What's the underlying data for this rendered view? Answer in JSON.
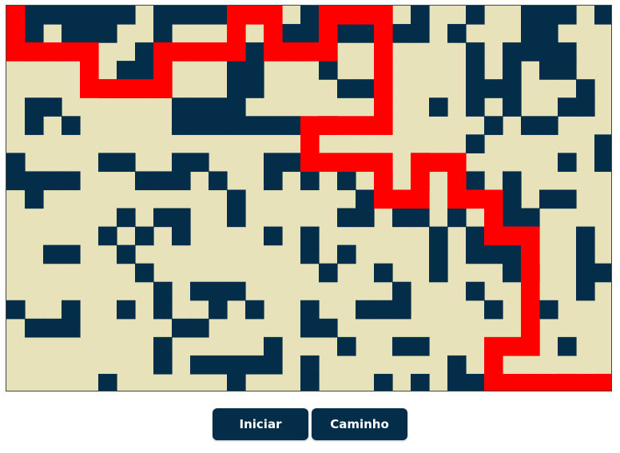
{
  "colors": {
    "wall": "#042d4a",
    "floor": "#e8e2bb",
    "path": "#ff0000",
    "button_bg": "#042d4a",
    "button_text": "#ffffff"
  },
  "maze": {
    "rows": 21,
    "cols": 33,
    "grid": [
      "#######.####....#...#.#..#..###.#",
      ".#.###..#......##.#####.#...##...",
      ".......#.....#...#.......#.####..",
      "......###...##...#.......#.#.##..",
      ".....####...##....##.....###...#.",
      ".##......####..........#.#.#..##.",
      ".#.#.....#######.#........#.##...",
      ".........................#......#",
      "#....##..##...##......#.......#.#",
      "####...###.#..#.#.#.#.#.##.#.....",
      ".#..........#......#....#..#.##..",
      "......#.##..#.....##.##.#..##....",
      ".....#.#.#....#.#......#.##....#.",
      "..##..#.........#.#....#.###...#.",
      ".......#.........#..#..#...##..##",
      "........#.###........#...#.....#.",
      "#..#..#.#..#.#..#..###....#..#...",
      ".###.....##.....##..........#....",
      "........#.....#...#..##.....#.#..",
      "........#.#####.#.......#........",
      ".....#......#...#...#.#.##....#.#"
    ],
    "path": [
      [
        0,
        0
      ],
      [
        1,
        0
      ],
      [
        2,
        0
      ],
      [
        2,
        1
      ],
      [
        2,
        2
      ],
      [
        2,
        3
      ],
      [
        2,
        4
      ],
      [
        3,
        4
      ],
      [
        4,
        4
      ],
      [
        4,
        5
      ],
      [
        4,
        6
      ],
      [
        4,
        7
      ],
      [
        4,
        8
      ],
      [
        3,
        8
      ],
      [
        2,
        8
      ],
      [
        2,
        9
      ],
      [
        2,
        10
      ],
      [
        2,
        11
      ],
      [
        2,
        12
      ],
      [
        1,
        12
      ],
      [
        0,
        12
      ],
      [
        0,
        13
      ],
      [
        0,
        14
      ],
      [
        1,
        14
      ],
      [
        2,
        14
      ],
      [
        2,
        15
      ],
      [
        2,
        16
      ],
      [
        2,
        17
      ],
      [
        1,
        17
      ],
      [
        0,
        17
      ],
      [
        0,
        18
      ],
      [
        0,
        19
      ],
      [
        0,
        20
      ],
      [
        1,
        20
      ],
      [
        2,
        20
      ],
      [
        3,
        20
      ],
      [
        4,
        20
      ],
      [
        5,
        20
      ],
      [
        6,
        20
      ],
      [
        6,
        19
      ],
      [
        6,
        18
      ],
      [
        6,
        17
      ],
      [
        6,
        16
      ],
      [
        7,
        16
      ],
      [
        8,
        16
      ],
      [
        8,
        17
      ],
      [
        8,
        18
      ],
      [
        8,
        19
      ],
      [
        8,
        20
      ],
      [
        9,
        20
      ],
      [
        10,
        20
      ],
      [
        10,
        21
      ],
      [
        10,
        22
      ],
      [
        9,
        22
      ],
      [
        8,
        22
      ],
      [
        8,
        23
      ],
      [
        8,
        24
      ],
      [
        9,
        24
      ],
      [
        10,
        24
      ],
      [
        10,
        25
      ],
      [
        10,
        26
      ],
      [
        11,
        26
      ],
      [
        12,
        26
      ],
      [
        12,
        27
      ],
      [
        12,
        28
      ],
      [
        13,
        28
      ],
      [
        14,
        28
      ],
      [
        15,
        28
      ],
      [
        16,
        28
      ],
      [
        17,
        28
      ],
      [
        18,
        28
      ],
      [
        18,
        27
      ],
      [
        18,
        26
      ],
      [
        19,
        26
      ],
      [
        20,
        26
      ],
      [
        20,
        27
      ],
      [
        20,
        28
      ],
      [
        20,
        29
      ],
      [
        20,
        30
      ],
      [
        20,
        31
      ],
      [
        20,
        32
      ]
    ]
  },
  "buttons": {
    "start_label": "Iniciar",
    "path_label": "Caminho"
  }
}
